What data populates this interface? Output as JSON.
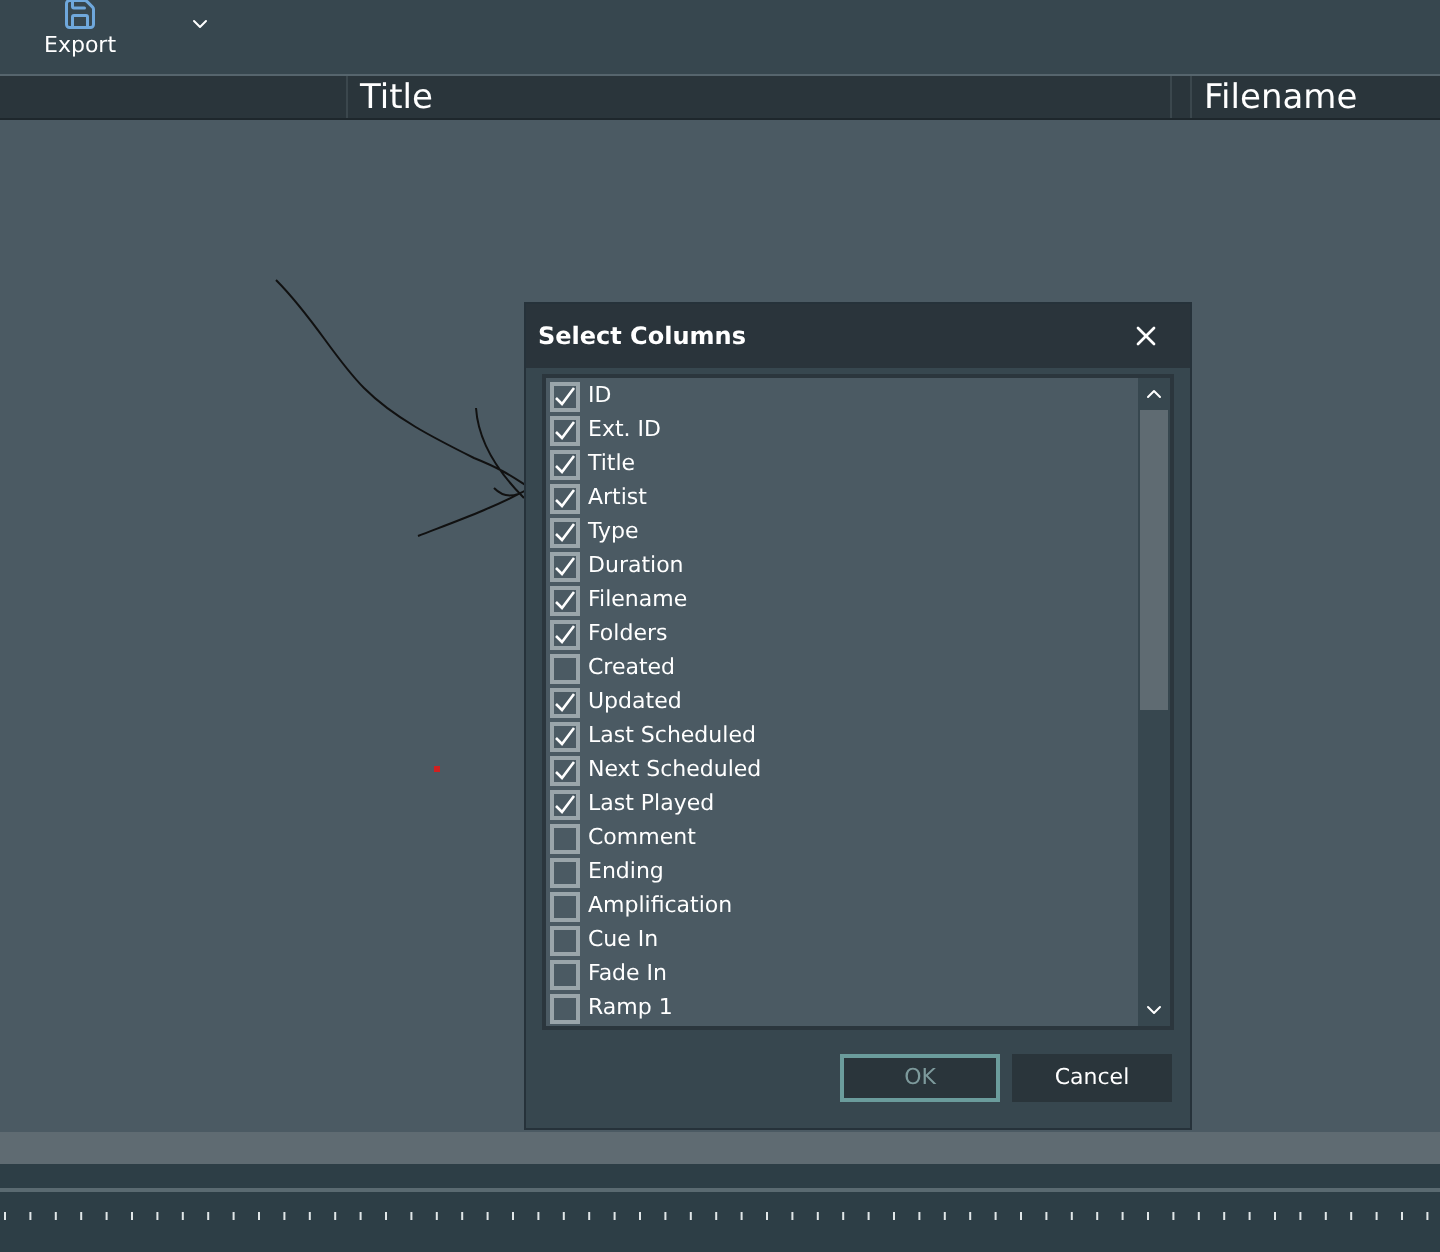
{
  "toolbar": {
    "export_label": "Export"
  },
  "table": {
    "columns": [
      "Title",
      "Filename"
    ]
  },
  "dialog": {
    "title": "Select Columns",
    "columns": [
      {
        "label": "ID",
        "checked": true
      },
      {
        "label": "Ext. ID",
        "checked": true
      },
      {
        "label": "Title",
        "checked": true
      },
      {
        "label": "Artist",
        "checked": true
      },
      {
        "label": "Type",
        "checked": true
      },
      {
        "label": "Duration",
        "checked": true
      },
      {
        "label": "Filename",
        "checked": true
      },
      {
        "label": "Folders",
        "checked": true
      },
      {
        "label": "Created",
        "checked": false
      },
      {
        "label": "Updated",
        "checked": true
      },
      {
        "label": "Last Scheduled",
        "checked": true
      },
      {
        "label": "Next Scheduled",
        "checked": true
      },
      {
        "label": "Last Played",
        "checked": true
      },
      {
        "label": "Comment",
        "checked": false
      },
      {
        "label": "Ending",
        "checked": false
      },
      {
        "label": "Amplification",
        "checked": false
      },
      {
        "label": "Cue In",
        "checked": false
      },
      {
        "label": "Fade In",
        "checked": false
      },
      {
        "label": "Ramp 1",
        "checked": false
      }
    ],
    "buttons": [
      {
        "label": "OK",
        "disabled": true
      },
      {
        "label": "Cancel",
        "disabled": false
      }
    ]
  }
}
